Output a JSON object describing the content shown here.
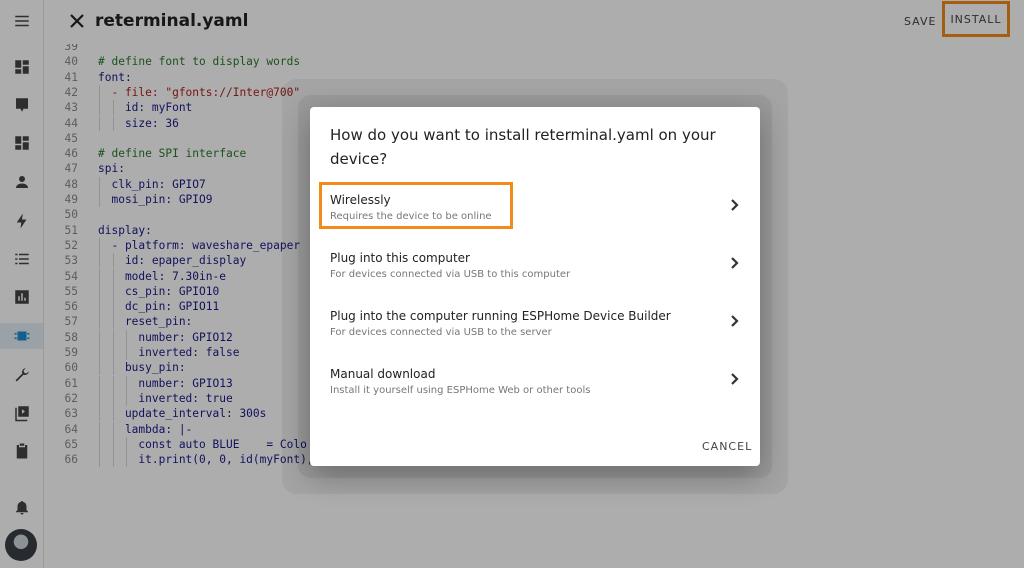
{
  "header": {
    "title": "reterminal.yaml",
    "save_label": "SAVE",
    "install_label": "INSTALL",
    "highlight_color": "#f28b1a"
  },
  "sidebar": {
    "items": [
      "menu-icon",
      "dashboard-icon",
      "map-icon",
      "dashboard-alt-icon",
      "person-icon",
      "lightning-icon",
      "list-icon",
      "chart-icon",
      "chip-icon",
      "wrench-icon",
      "media-icon",
      "clipboard-icon",
      "bell-icon",
      "avatar"
    ],
    "active": "chip-icon",
    "accent_color": "#1f8bd1"
  },
  "editor": {
    "lines": [
      {
        "n": "39",
        "t": ""
      },
      {
        "n": "40",
        "t": "# define font to display words"
      },
      {
        "n": "41",
        "t": "font:"
      },
      {
        "n": "42",
        "t": "  - file: \"gfonts://Inter@700\""
      },
      {
        "n": "43",
        "t": "    id: myFont"
      },
      {
        "n": "44",
        "t": "    size: 36"
      },
      {
        "n": "45",
        "t": ""
      },
      {
        "n": "46",
        "t": "# define SPI interface"
      },
      {
        "n": "47",
        "t": "spi:"
      },
      {
        "n": "48",
        "t": "  clk_pin: GPIO7"
      },
      {
        "n": "49",
        "t": "  mosi_pin: GPIO9"
      },
      {
        "n": "50",
        "t": ""
      },
      {
        "n": "51",
        "t": "display:"
      },
      {
        "n": "52",
        "t": "  - platform: waveshare_epaper"
      },
      {
        "n": "53",
        "t": "    id: epaper_display"
      },
      {
        "n": "54",
        "t": "    model: 7.30in-e"
      },
      {
        "n": "55",
        "t": "    cs_pin: GPIO10"
      },
      {
        "n": "56",
        "t": "    dc_pin: GPIO11"
      },
      {
        "n": "57",
        "t": "    reset_pin:"
      },
      {
        "n": "58",
        "t": "      number: GPIO12"
      },
      {
        "n": "59",
        "t": "      inverted: false"
      },
      {
        "n": "60",
        "t": "    busy_pin:"
      },
      {
        "n": "61",
        "t": "      number: GPIO13"
      },
      {
        "n": "62",
        "t": "      inverted: true"
      },
      {
        "n": "63",
        "t": "    update_interval: 300s"
      },
      {
        "n": "64",
        "t": "    lambda: |-"
      },
      {
        "n": "65",
        "t": "      const auto BLUE    = Colo"
      },
      {
        "n": "66",
        "t": "      it.print(0, 0, id(myFont),"
      }
    ]
  },
  "dialog": {
    "title": "How do you want to install reterminal.yaml on your device?",
    "options": [
      {
        "title": "Wirelessly",
        "subtitle": "Requires the device to be online"
      },
      {
        "title": "Plug into this computer",
        "subtitle": "For devices connected via USB to this computer"
      },
      {
        "title": "Plug into the computer running ESPHome Device Builder",
        "subtitle": "For devices connected via USB to the server"
      },
      {
        "title": "Manual download",
        "subtitle": "Install it yourself using ESPHome Web or other tools"
      }
    ],
    "cancel_label": "CANCEL"
  }
}
